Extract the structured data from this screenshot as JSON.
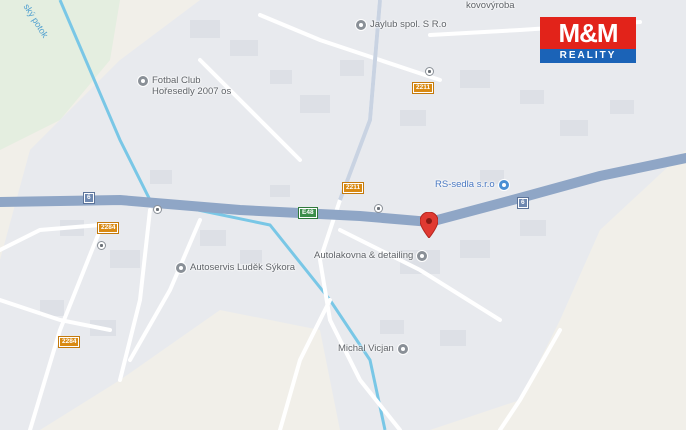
{
  "logo": {
    "line1": "M&M",
    "line2": "REALITY"
  },
  "pois": [
    {
      "id": "jaylub",
      "label": "Jaylub spol. S R.o",
      "color": "gray"
    },
    {
      "id": "kovovyroba",
      "label": "kovovýroba",
      "color": "gray"
    },
    {
      "id": "fotbal",
      "label": "Fotbal Club\nHořesedly 2007 os",
      "color": "gray"
    },
    {
      "id": "rs-sedla",
      "label": "RS-sedla s.r.o",
      "color": "blue"
    },
    {
      "id": "autolakovna",
      "label": "Autolakovna & detailing",
      "color": "gray"
    },
    {
      "id": "autoservis",
      "label": "Autoservis Luděk Sýkora",
      "color": "gray"
    },
    {
      "id": "michal",
      "label": "Michal Vicjan",
      "color": "gray"
    }
  ],
  "road_shields": [
    {
      "id": "r2211a",
      "label": "2211",
      "style": "orange"
    },
    {
      "id": "r2211b",
      "label": "2211",
      "style": "orange"
    },
    {
      "id": "r2284a",
      "label": "2284",
      "style": "orange"
    },
    {
      "id": "r2284b",
      "label": "2284",
      "style": "orange"
    },
    {
      "id": "r6a",
      "label": "6",
      "style": "blue"
    },
    {
      "id": "r6b",
      "label": "6",
      "style": "blue"
    },
    {
      "id": "e48",
      "label": "E48",
      "style": "green"
    }
  ],
  "stream": {
    "label": "ský potok"
  },
  "colors": {
    "land": "#f1efe9",
    "urban": "#e8eaee",
    "main_road": "#8fa6c6",
    "minor_road": "#ffffff",
    "water": "#79c7e6",
    "green": "#dcecd6",
    "marker": "#e03a32"
  }
}
